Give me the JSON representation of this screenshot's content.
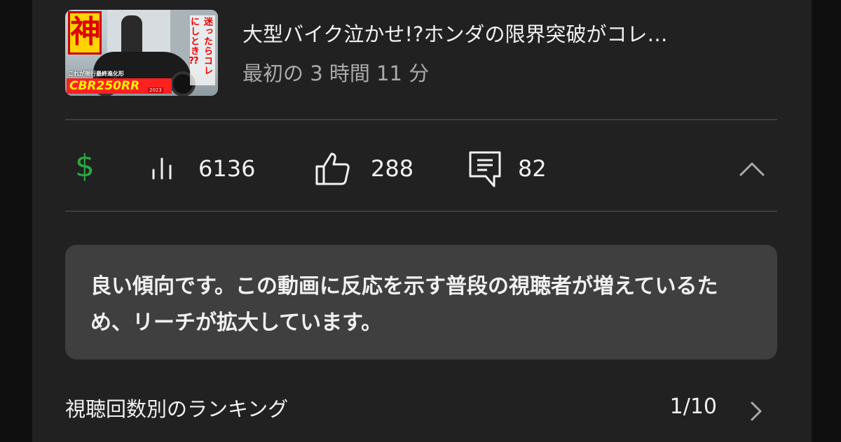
{
  "video": {
    "title": "大型バイク泣かせ!?ホンダの限界突破がコレ…",
    "subtitle": "最初の 3 時間 11 分",
    "thumbnail": {
      "kanji": "神",
      "vertical_text": "迷ったらコレにしとき⁇",
      "small_text": "これが現行最終進化形",
      "model": "CBR250RR",
      "year": "2023"
    }
  },
  "stats": {
    "revenue_icon": "dollar-icon",
    "accent_color": "#2ba640",
    "views": "6136",
    "likes": "288",
    "comments": "82"
  },
  "insight": {
    "text": "良い傾向です。この動画に反応を示す普段の視聴者が増えているため、リーチが拡大しています。"
  },
  "ranking": {
    "label": "視聴回数別のランキング",
    "value": "1/10"
  }
}
